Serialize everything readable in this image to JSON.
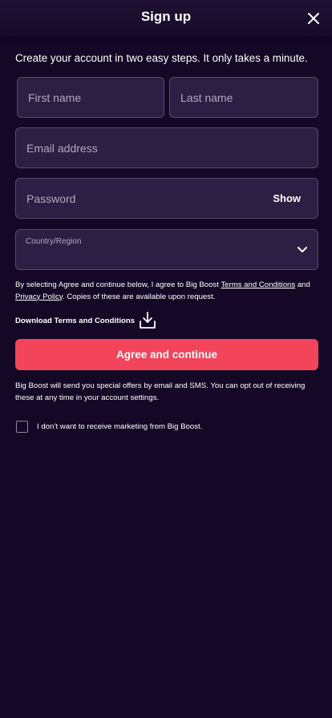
{
  "header": {
    "title": "Sign up",
    "close_icon": "close-icon"
  },
  "intro": "Create your account in two easy steps. It only takes a minute.",
  "form": {
    "first_name": {
      "placeholder": "First name",
      "value": ""
    },
    "last_name": {
      "placeholder": "Last name",
      "value": ""
    },
    "email": {
      "placeholder": "Email address",
      "value": ""
    },
    "password": {
      "placeholder": "Password",
      "value": "",
      "show_label": "Show"
    },
    "country": {
      "label": "Country/Region",
      "value": "",
      "icon": "chevron-down-icon"
    }
  },
  "legal": {
    "prefix": "By selecting Agree and continue below, I agree to Big Boost ",
    "terms_link": "Terms and Conditions",
    "and": " and ",
    "privacy_link": "Privacy Policy",
    "suffix": ". Copies of these are available upon request."
  },
  "download": {
    "label": "Download Terms and Conditions",
    "icon": "download-icon"
  },
  "primary_button": {
    "label": "Agree and continue",
    "color": "#f2445a"
  },
  "marketing_note": "Big Boost will send you special offers by email and SMS. You can opt out of receiving these at any time in your account settings.",
  "optout": {
    "label": "I don’t want to receive marketing from Big Boost.",
    "checked": false
  },
  "colors": {
    "background": "#140826",
    "field_background": "#2c1f43",
    "field_border": "#574a6e",
    "accent": "#f2445a"
  }
}
